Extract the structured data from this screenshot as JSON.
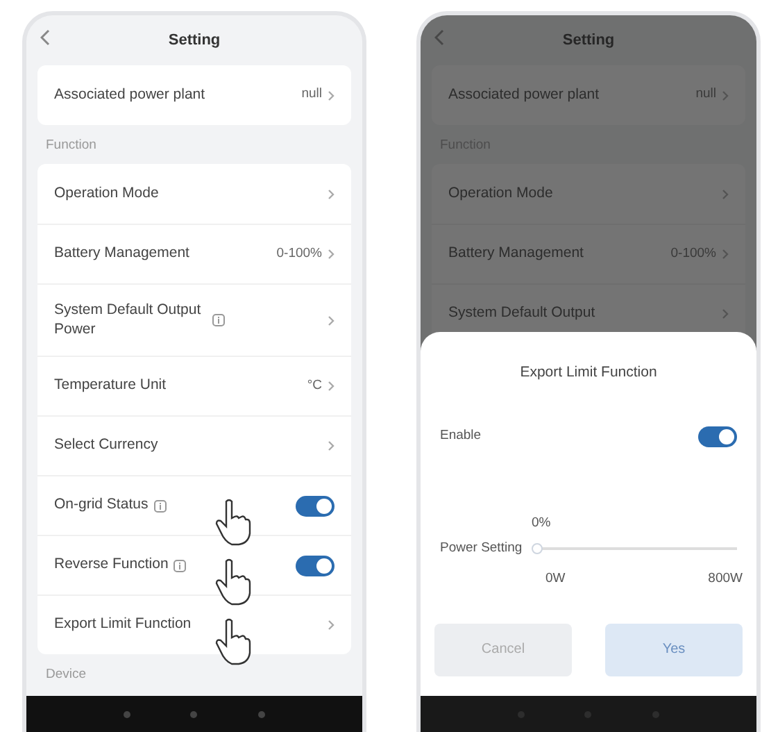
{
  "left_screen": {
    "title": "Setting",
    "items": [
      {
        "kind": "row",
        "label": "Associated power plant",
        "value": "null",
        "tapped": false
      },
      {
        "kind": "header",
        "label": "Function"
      },
      {
        "kind": "row",
        "label": "Operation Mode",
        "tapped": false
      },
      {
        "kind": "row",
        "label": "Battery Management",
        "value": "0-100%",
        "tapped": false
      },
      {
        "kind": "row",
        "label": "System Default Output Power",
        "info": true,
        "tapped": false
      },
      {
        "kind": "row",
        "label": "Temperature Unit",
        "value": "°C",
        "tapped": false
      },
      {
        "kind": "row",
        "label": "Select Currency",
        "tapped": false
      },
      {
        "kind": "toggle",
        "label": "On-grid Status",
        "info": true,
        "on": true,
        "tapped": true
      },
      {
        "kind": "toggle",
        "label": "Reverse Function",
        "info": true,
        "on": true,
        "tapped": true
      },
      {
        "kind": "row",
        "label": "Export Limit Function",
        "tapped": true
      },
      {
        "kind": "header",
        "label": "Device"
      }
    ]
  },
  "right_screen": {
    "title": "Setting",
    "items": [
      {
        "kind": "row",
        "label": "Associated power plant",
        "value": "null"
      },
      {
        "kind": "header",
        "label": "Function"
      },
      {
        "kind": "row",
        "label": "Operation Mode"
      },
      {
        "kind": "row",
        "label": "Battery Management",
        "value": "0-100%"
      },
      {
        "kind": "row",
        "label": "System Default Output"
      }
    ],
    "sheet": {
      "title": "Export Limit Function",
      "enable_label": "Enable",
      "enable_on": true,
      "slider": {
        "label": "Power Setting",
        "reading": "0%",
        "level": 0,
        "min_label": "0W",
        "max_label": "800W"
      },
      "buttons": [
        {
          "label": "Cancel",
          "kind": "secondary"
        },
        {
          "label": "Yes",
          "kind": "primary"
        }
      ]
    }
  }
}
